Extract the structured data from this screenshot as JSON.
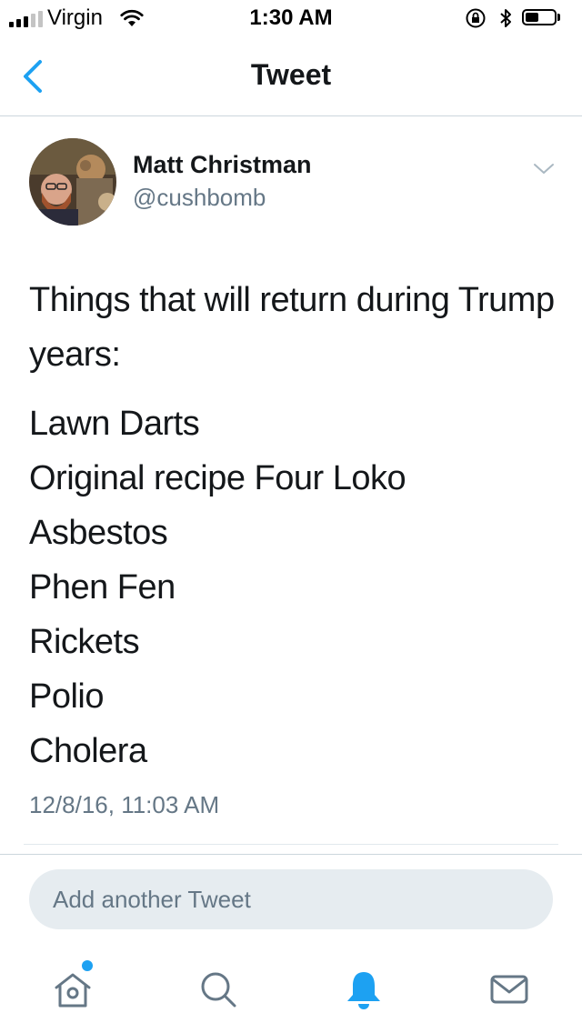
{
  "status_bar": {
    "carrier": "Virgin",
    "time": "1:30 AM",
    "battery_level": 0.45
  },
  "nav": {
    "title": "Tweet",
    "back_icon": "chevron-left-icon"
  },
  "tweet": {
    "author": {
      "display_name": "Matt Christman",
      "handle": "@cushbomb"
    },
    "lead": "Things that will return during Trump years:",
    "items": [
      "Lawn Darts",
      "Original recipe Four Loko",
      "Asbestos",
      "Phen Fen",
      "Rickets",
      "Polio",
      "Cholera"
    ],
    "timestamp": "12/8/16, 11:03 AM"
  },
  "reply": {
    "placeholder": "Add another Tweet"
  },
  "tab_bar": {
    "tabs": [
      {
        "icon": "home-icon",
        "active": false,
        "has_badge": true
      },
      {
        "icon": "search-icon",
        "active": false,
        "has_badge": false
      },
      {
        "icon": "bell-icon",
        "active": true,
        "has_badge": false
      },
      {
        "icon": "mail-icon",
        "active": false,
        "has_badge": false
      }
    ]
  },
  "colors": {
    "accent": "#1da1f2",
    "text_primary": "#14171a",
    "text_secondary": "#657786",
    "reply_bg": "#e6ecf0"
  }
}
